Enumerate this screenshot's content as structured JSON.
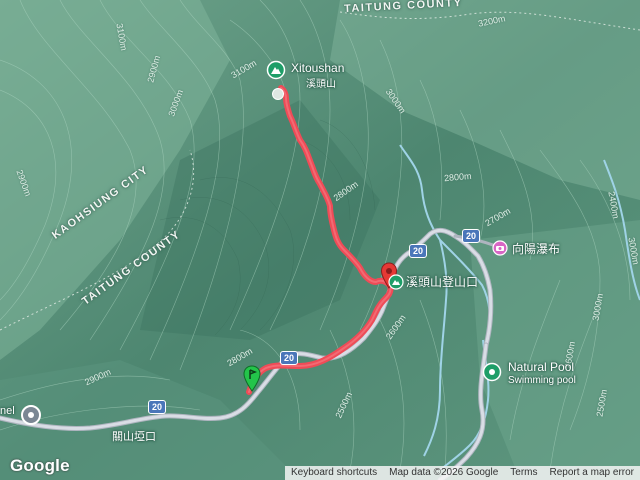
{
  "map": {
    "region_labels": {
      "taitung_county_top": "TAITUNG COUNTY",
      "kaohsiung_city": "KAOHSIUNG CITY",
      "taitung_county_mid": "TAITUNG COUNTY"
    },
    "contour_labels": [
      "3200m",
      "3100m",
      "2900m",
      "3000m",
      "3100m",
      "3000m",
      "2800m",
      "2800m",
      "2700m",
      "2900m",
      "3000m",
      "2600m",
      "2800m",
      "2900m",
      "2500m",
      "2600m",
      "2500m",
      "2400m",
      "3000m",
      "2900m",
      "2800m",
      "2700m",
      "2600m",
      "2500m"
    ],
    "pois": {
      "summit": {
        "name": "Xitoushan",
        "sub": "溪頭山"
      },
      "trailhead": {
        "name": "溪頭山登山口"
      },
      "waterfall": {
        "name": "向陽瀑布"
      },
      "natural_pool": {
        "name": "Natural Pool",
        "sub": "Swimming pool"
      },
      "west_place": {
        "name": "nel"
      },
      "guanshan_pass": {
        "name": "關山埡口"
      }
    },
    "road_shields": [
      "20",
      "20",
      "20",
      "20"
    ],
    "track": {
      "color": "#ef4b57"
    },
    "colors": {
      "terrain": "#4f8a74",
      "road": "#c7ccd6",
      "river": "#9fd3e6",
      "track": "#ef4b57",
      "poi_green": "#1e9e68",
      "poi_pink": "#d766c4"
    }
  },
  "footer": {
    "logo": "Google",
    "keyboard_shortcuts": "Keyboard shortcuts",
    "map_data": "Map data ©2026 Google",
    "terms": "Terms",
    "report": "Report a map error"
  }
}
